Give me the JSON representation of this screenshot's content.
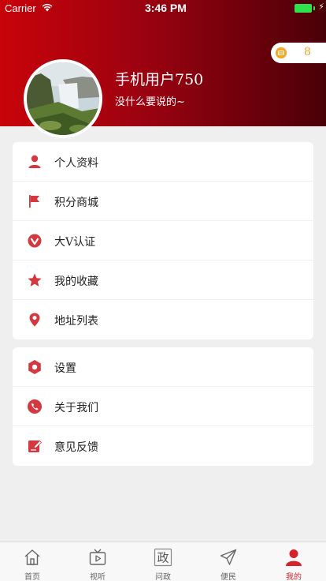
{
  "status_bar": {
    "carrier": "Carrier",
    "time": "3:46 PM",
    "charge_symbol": "⚡",
    "battery_color": "#2ee34b"
  },
  "profile": {
    "username": "手机用户750",
    "signature": "没什么要说的~",
    "points": "8",
    "coin_icon": "coin-icon"
  },
  "menu_group_1": [
    {
      "label": "个人资料",
      "icon": "person-icon"
    },
    {
      "label": "积分商城",
      "icon": "flag-icon"
    },
    {
      "label": "大V认证",
      "icon": "v-badge-icon"
    },
    {
      "label": "我的收藏",
      "icon": "star-icon"
    },
    {
      "label": "地址列表",
      "icon": "location-pin-icon"
    }
  ],
  "menu_group_2": [
    {
      "label": "设置",
      "icon": "gear-icon"
    },
    {
      "label": "关于我们",
      "icon": "phone-icon"
    },
    {
      "label": "意见反馈",
      "icon": "edit-icon"
    }
  ],
  "tabs": [
    {
      "label": "首页",
      "icon": "home-icon",
      "active": false
    },
    {
      "label": "视听",
      "icon": "tv-play-icon",
      "active": false
    },
    {
      "label": "问政",
      "icon": "zheng-icon",
      "glyph": "政",
      "active": false
    },
    {
      "label": "便民",
      "icon": "send-icon",
      "active": false
    },
    {
      "label": "我的",
      "icon": "profile-icon",
      "active": true
    }
  ],
  "colors": {
    "accent": "#d3242c",
    "header_start": "#c8030a",
    "header_end": "#4a0008",
    "points_text": "#f0a22b"
  }
}
